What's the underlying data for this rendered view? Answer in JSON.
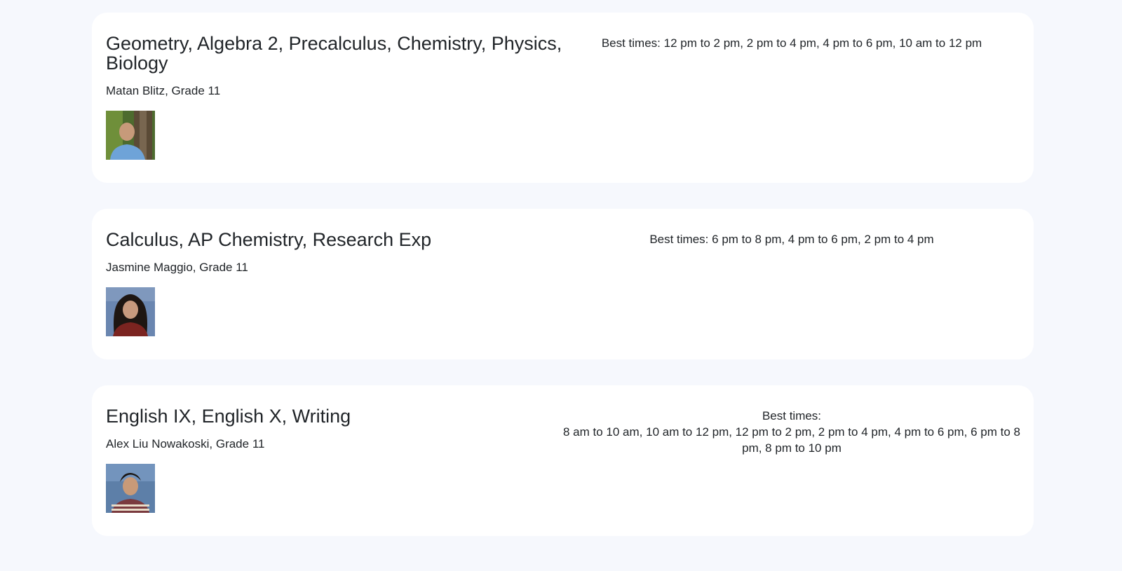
{
  "tutors": [
    {
      "subjects": "Geometry, Algebra 2, Precalculus, Chemistry, Physics, Biology",
      "name_grade": "Matan Blitz, Grade 11",
      "photo": "portrait-photo",
      "best_times_label": "Best times:",
      "best_times": "12 pm to 2 pm, 2 pm to 4 pm, 4 pm to 6 pm, 10 am to 12 pm"
    },
    {
      "subjects": "Calculus, AP Chemistry, Research Exp",
      "name_grade": "Jasmine Maggio, Grade 11",
      "photo": "portrait-photo",
      "best_times_label": "Best times:",
      "best_times": "6 pm to 8 pm, 4 pm to 6 pm, 2 pm to 4 pm"
    },
    {
      "subjects": "English IX, English X, Writing",
      "name_grade": "Alex Liu Nowakoski, Grade 11",
      "photo": "portrait-photo",
      "best_times_label": "Best times:",
      "best_times": "8 am to 10 am, 10 am to 12 pm, 12 pm to 2 pm, 2 pm to 4 pm, 4 pm to 6 pm, 6 pm to 8 pm, 8 pm to 10 pm"
    }
  ]
}
